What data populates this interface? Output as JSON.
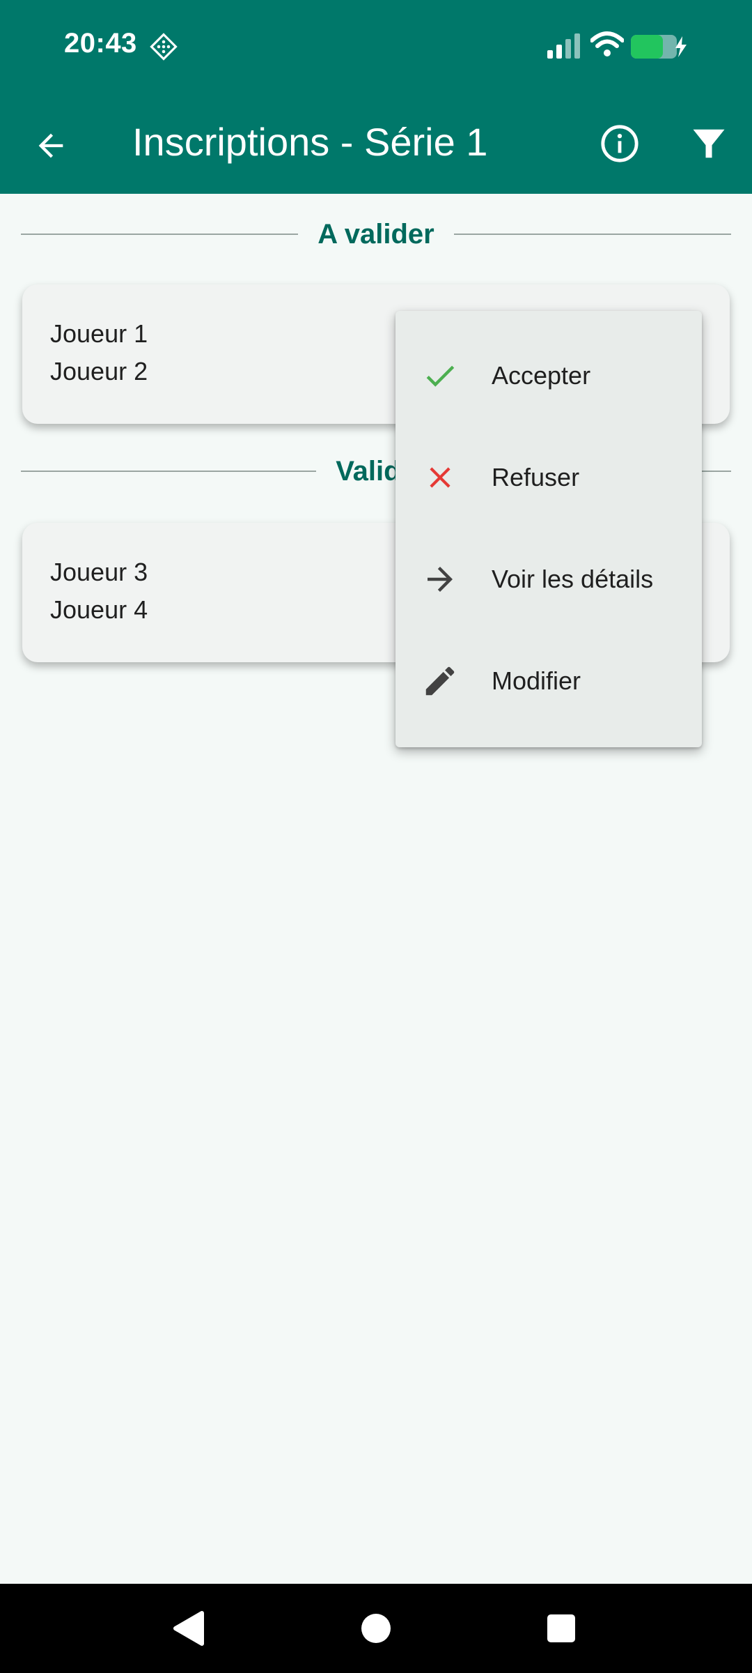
{
  "status_bar": {
    "time": "20:43",
    "icons": [
      "notification-icon",
      "signal-icon",
      "wifi-icon",
      "battery-charging-icon"
    ],
    "battery_color": "#22c55e"
  },
  "app_bar": {
    "title": "Inscriptions - Série 1",
    "background": "#00786a",
    "icons": [
      "back-arrow-icon",
      "info-icon",
      "filter-icon"
    ]
  },
  "sections": [
    {
      "label": "A valider",
      "cards": [
        {
          "players": [
            "Joueur 1",
            "Joueur 2"
          ]
        }
      ]
    },
    {
      "label": "Validé",
      "cards": [
        {
          "players": [
            "Joueur 3",
            "Joueur 4"
          ]
        }
      ]
    }
  ],
  "popup_menu": {
    "items": [
      {
        "label": "Accepter",
        "icon": "check-icon",
        "color": "#4caf50"
      },
      {
        "label": "Refuser",
        "icon": "close-icon",
        "color": "#e53935"
      },
      {
        "label": "Voir les détails",
        "icon": "arrow-right-icon",
        "color": "#424242"
      },
      {
        "label": "Modifier",
        "icon": "edit-pencil-icon",
        "color": "#424242"
      }
    ]
  },
  "nav_bar": {
    "icons": [
      "nav-back-icon",
      "nav-home-icon",
      "nav-recent-icon"
    ]
  }
}
